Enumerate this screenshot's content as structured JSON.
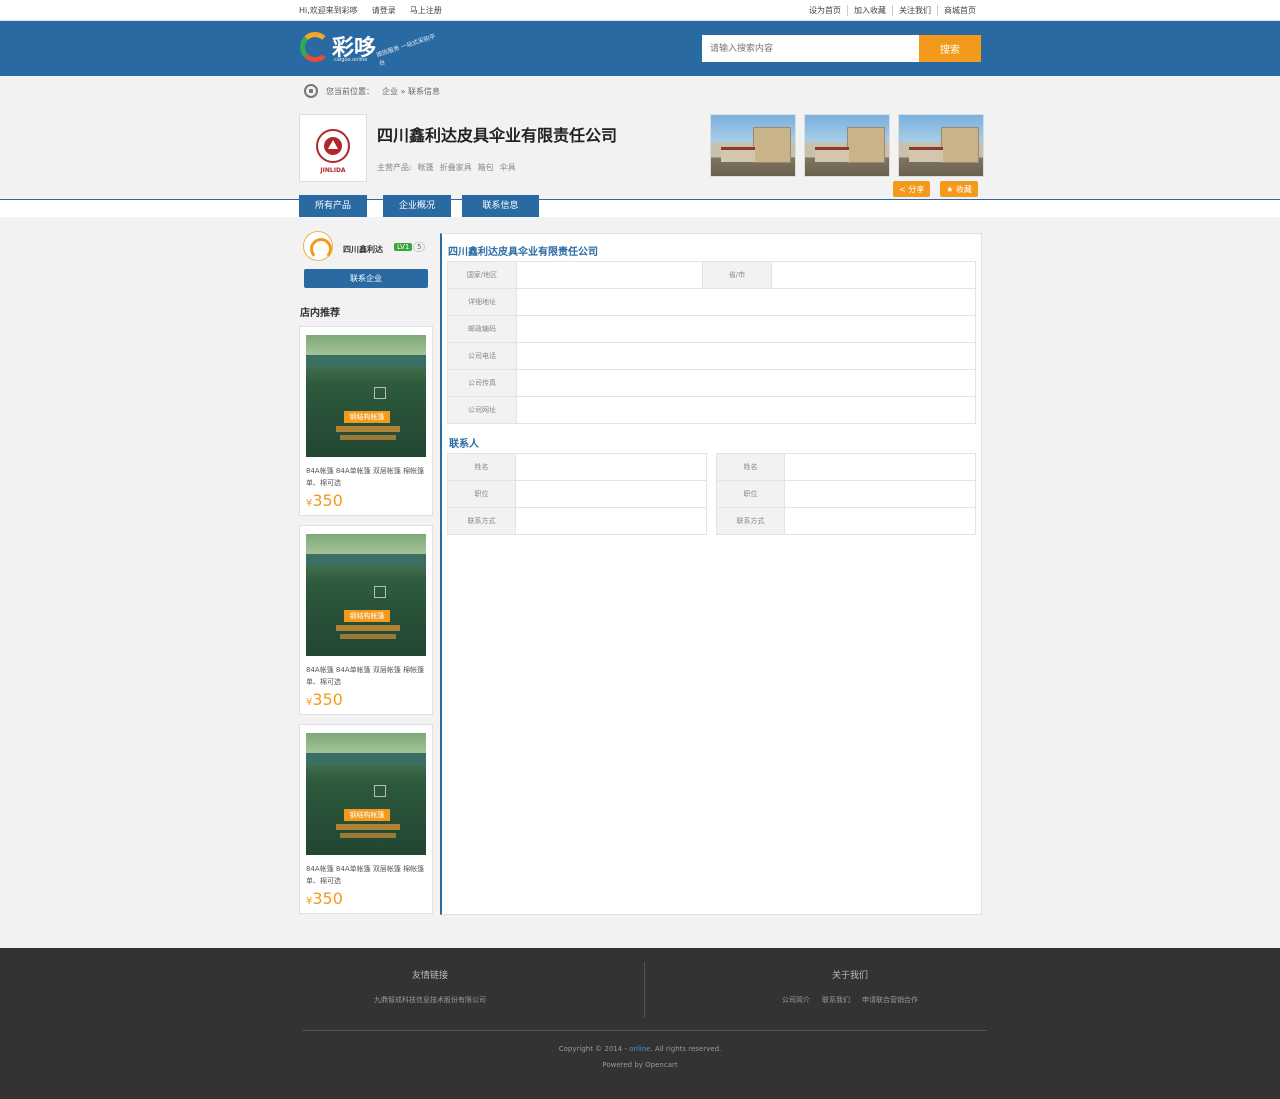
{
  "topbar": {
    "left": [
      "Hi,欢迎来到彩哆",
      "请登录",
      "马上注册"
    ],
    "right": [
      "设为首页",
      "加入收藏",
      "关注我们",
      "商城首页"
    ]
  },
  "header": {
    "logo_name": "彩哆",
    "logo_domain": "caiguo.online",
    "logo_slogan": "诚信服务 一站式采购平台",
    "search_placeholder": "请输入搜索内容",
    "search_button": "搜索"
  },
  "breadcrumb": {
    "prefix": "您当前位置：",
    "path": "企业 » 联系信息"
  },
  "company": {
    "brand_text": "JINLIDA",
    "name": "四川鑫利达皮具伞业有限责任公司",
    "products_label": "主营产品:",
    "products": [
      "帐篷",
      "折叠家具",
      "箱包",
      "伞具"
    ],
    "share_label": "分享",
    "favorite_label": "收藏"
  },
  "tabs": [
    "所有产品",
    "企业概况",
    "联系信息"
  ],
  "sidebar": {
    "shop_name": "四川鑫利达",
    "level": "LV1",
    "level_num": "5",
    "contact_button": "联系企业",
    "section_title": "店内推荐",
    "products": [
      {
        "title": "84A帐篷 84A单帐篷 双层帐篷 棉帐篷 单、棉可选",
        "currency": "¥",
        "price": "350",
        "sign": "钢结构帐篷"
      },
      {
        "title": "84A帐篷 84A单帐篷 双层帐篷 棉帐篷 单、棉可选",
        "currency": "¥",
        "price": "350",
        "sign": "钢结构帐篷"
      },
      {
        "title": "84A帐篷 84A单帐篷 双层帐篷 棉帐篷 单、棉可选",
        "currency": "¥",
        "price": "350",
        "sign": "钢结构帐篷"
      }
    ]
  },
  "main": {
    "title": "四川鑫利达皮具伞业有限责任公司",
    "info_rows": {
      "country": "国家/地区",
      "province": "省/市",
      "address": "详细地址",
      "postcode": "邮政编码",
      "phone": "公司电话",
      "fax": "公司传真",
      "website": "公司网址"
    },
    "contacts_title": "联系人",
    "contact_fields": [
      "姓名",
      "职位",
      "联系方式"
    ]
  },
  "footer": {
    "links_title": "友情链接",
    "links": [
      "九鼎智成科技信息技术股份有限公司"
    ],
    "about_title": "关于我们",
    "about_links": [
      "公司简介",
      "联系我们",
      "申请联合营销合作"
    ],
    "copyright_pre": "Copyright © 2014 -",
    "copyright_brand": "online",
    "copyright_post": ". All rights reserved.",
    "powered": "Powered by Opencart"
  },
  "colors": {
    "brand_blue": "#2a6aa3",
    "accent_orange": "#f39a1d",
    "footer_bg": "#333333"
  }
}
